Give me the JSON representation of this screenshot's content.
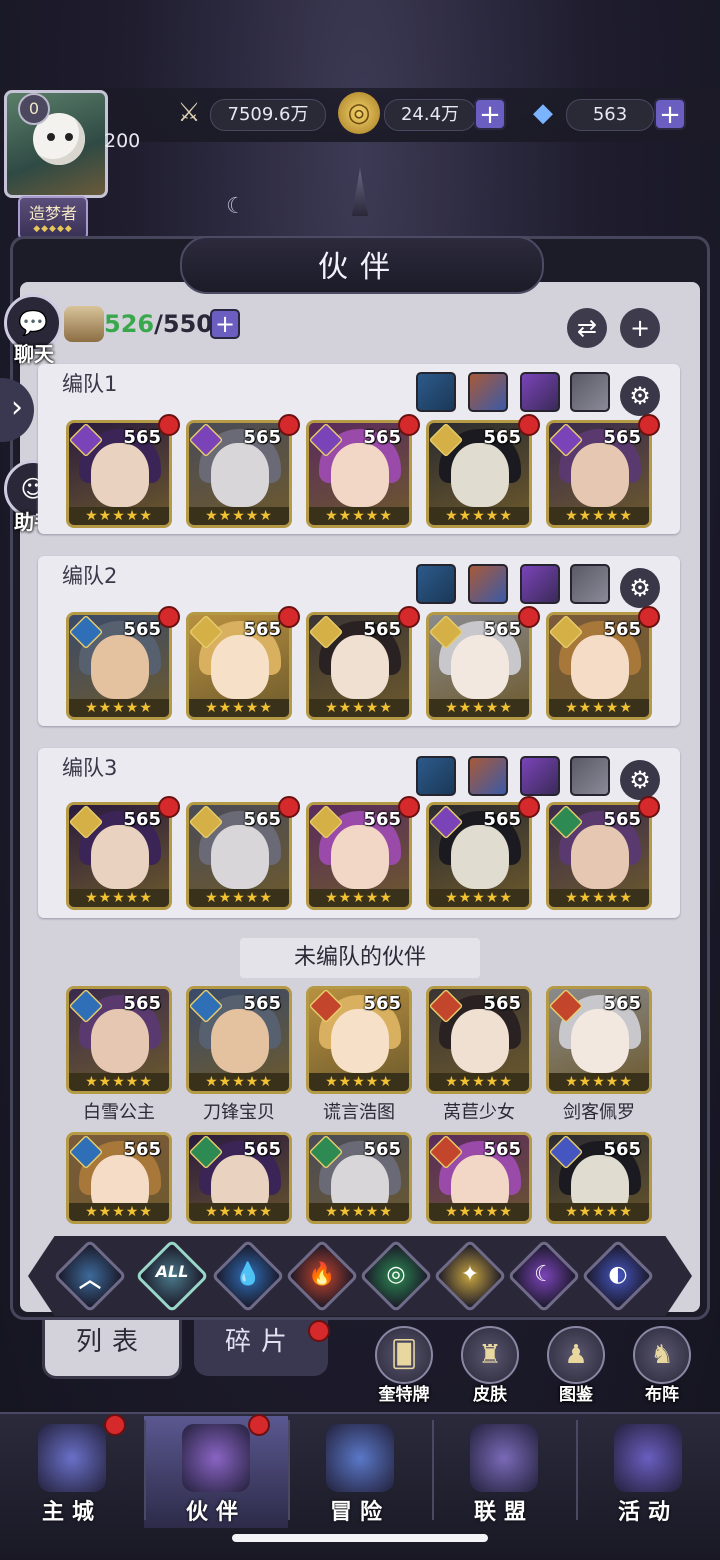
{
  "player": {
    "level": "0",
    "sub_level": "200",
    "title": "造梦者"
  },
  "resources": {
    "power": "7509.6万",
    "gold": "24.4万",
    "diamond": "563"
  },
  "header": {
    "title": "伙伴"
  },
  "side": {
    "chat": "聊天",
    "assistant": "助手"
  },
  "roster": {
    "current": "526",
    "total": "/550"
  },
  "teams": [
    {
      "name": "编队1",
      "heroes": [
        {
          "level": "565",
          "element": "purple"
        },
        {
          "level": "565",
          "element": "purple"
        },
        {
          "level": "565",
          "element": "purple"
        },
        {
          "level": "565",
          "element": "gold"
        },
        {
          "level": "565",
          "element": "purple"
        }
      ]
    },
    {
      "name": "编队2",
      "heroes": [
        {
          "level": "565",
          "element": "blue"
        },
        {
          "level": "565",
          "element": "gold"
        },
        {
          "level": "565",
          "element": "gold"
        },
        {
          "level": "565",
          "element": "gold"
        },
        {
          "level": "565",
          "element": "gold"
        }
      ]
    },
    {
      "name": "编队3",
      "heroes": [
        {
          "level": "565",
          "element": "gold"
        },
        {
          "level": "565",
          "element": "gold"
        },
        {
          "level": "565",
          "element": "gold"
        },
        {
          "level": "565",
          "element": "purple"
        },
        {
          "level": "565",
          "element": "green"
        }
      ]
    }
  ],
  "unassigned": {
    "title": "未编队的伙伴",
    "heroes": [
      {
        "name": "白雪公主",
        "level": "565",
        "element": "blue"
      },
      {
        "name": "刀锋宝贝",
        "level": "565",
        "element": "blue"
      },
      {
        "name": "谎言浩图",
        "level": "565",
        "element": "red"
      },
      {
        "name": "莴苣少女",
        "level": "565",
        "element": "red"
      },
      {
        "name": "剑客佩罗",
        "level": "565",
        "element": "red"
      },
      {
        "name": "",
        "level": "565",
        "element": "blue"
      },
      {
        "name": "",
        "level": "565",
        "element": "green"
      },
      {
        "name": "",
        "level": "565",
        "element": "green"
      },
      {
        "name": "",
        "level": "565",
        "element": "red"
      },
      {
        "name": "",
        "level": "565",
        "element": "indigo"
      }
    ]
  },
  "filters": [
    {
      "id": "up",
      "glyph": "︿",
      "color": "#3d6b9a"
    },
    {
      "id": "all",
      "glyph": "ALL",
      "color": "#4b7a8a"
    },
    {
      "id": "water",
      "glyph": "💧",
      "color": "#2f6fb8"
    },
    {
      "id": "fire",
      "glyph": "🔥",
      "color": "#c2452c"
    },
    {
      "id": "wind",
      "glyph": "◎",
      "color": "#2d8a52"
    },
    {
      "id": "light",
      "glyph": "✦",
      "color": "#c7a440"
    },
    {
      "id": "dark",
      "glyph": "☾",
      "color": "#7b44b8"
    },
    {
      "id": "cosmos",
      "glyph": "◐",
      "color": "#4656c0"
    }
  ],
  "tabs": {
    "list": "列表",
    "fragments": "碎片"
  },
  "tools": [
    {
      "label": "奎特牌",
      "glyph": "🂠"
    },
    {
      "label": "皮肤",
      "glyph": "♜"
    },
    {
      "label": "图鉴",
      "glyph": "♟"
    },
    {
      "label": "布阵",
      "glyph": "♞"
    }
  ],
  "nav": [
    {
      "label": "主城",
      "color": "#6a70c8"
    },
    {
      "label": "伙伴",
      "color": "#8a64c4"
    },
    {
      "label": "冒险",
      "color": "#5a78c8"
    },
    {
      "label": "联盟",
      "color": "#7a6ab8"
    },
    {
      "label": "活动",
      "color": "#6a5ec0"
    }
  ],
  "colors": {
    "accent_plus": "#6a5ec0",
    "badge_red": "#d6292b",
    "stars": "#f2c233"
  }
}
